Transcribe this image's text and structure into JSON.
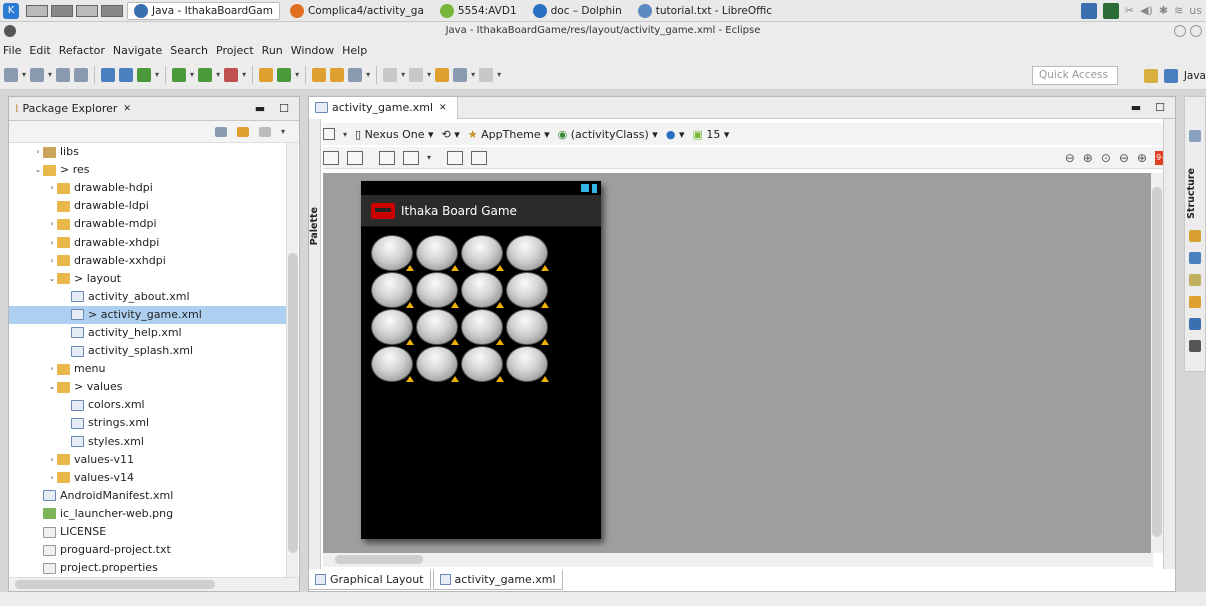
{
  "taskbar": {
    "tasks": [
      {
        "label": "Java - IthakaBoardGam",
        "active": true
      },
      {
        "label": "Complica4/activity_ga"
      },
      {
        "label": "5554:AVD1"
      },
      {
        "label": "doc – Dolphin"
      },
      {
        "label": "tutorial.txt - LibreOffic"
      }
    ],
    "tray_text": "us"
  },
  "window": {
    "title": "Java - IthakaBoardGame/res/layout/activity_game.xml - Eclipse"
  },
  "menu": [
    "File",
    "Edit",
    "Refactor",
    "Navigate",
    "Search",
    "Project",
    "Run",
    "Window",
    "Help"
  ],
  "toolbar": {
    "quick_access_placeholder": "Quick Access",
    "perspective_label": "Java"
  },
  "package_explorer": {
    "title": "Package Explorer",
    "tree": [
      {
        "indent": 1,
        "twisty": ">",
        "icon": "lib",
        "label": "libs"
      },
      {
        "indent": 1,
        "twisty": "v",
        "icon": "folder",
        "label": "> res"
      },
      {
        "indent": 2,
        "twisty": ">",
        "icon": "folder",
        "label": "drawable-hdpi"
      },
      {
        "indent": 2,
        "twisty": "",
        "icon": "folder",
        "label": "drawable-ldpi"
      },
      {
        "indent": 2,
        "twisty": ">",
        "icon": "folder",
        "label": "drawable-mdpi"
      },
      {
        "indent": 2,
        "twisty": ">",
        "icon": "folder",
        "label": "drawable-xhdpi"
      },
      {
        "indent": 2,
        "twisty": ">",
        "icon": "folder",
        "label": "drawable-xxhdpi"
      },
      {
        "indent": 2,
        "twisty": "v",
        "icon": "folder",
        "label": "> layout"
      },
      {
        "indent": 3,
        "twisty": "",
        "icon": "xml",
        "label": "activity_about.xml"
      },
      {
        "indent": 3,
        "twisty": "",
        "icon": "xml",
        "label": "> activity_game.xml",
        "selected": true
      },
      {
        "indent": 3,
        "twisty": "",
        "icon": "xml",
        "label": "activity_help.xml"
      },
      {
        "indent": 3,
        "twisty": "",
        "icon": "xml",
        "label": "activity_splash.xml"
      },
      {
        "indent": 2,
        "twisty": ">",
        "icon": "folder",
        "label": "menu"
      },
      {
        "indent": 2,
        "twisty": "v",
        "icon": "folder",
        "label": "> values"
      },
      {
        "indent": 3,
        "twisty": "",
        "icon": "xml",
        "label": "colors.xml"
      },
      {
        "indent": 3,
        "twisty": "",
        "icon": "xml",
        "label": "strings.xml"
      },
      {
        "indent": 3,
        "twisty": "",
        "icon": "xml",
        "label": "styles.xml"
      },
      {
        "indent": 2,
        "twisty": ">",
        "icon": "folder",
        "label": "values-v11"
      },
      {
        "indent": 2,
        "twisty": ">",
        "icon": "folder",
        "label": "values-v14"
      },
      {
        "indent": 1,
        "twisty": "",
        "icon": "xml",
        "label": "AndroidManifest.xml"
      },
      {
        "indent": 1,
        "twisty": "",
        "icon": "png",
        "label": "ic_launcher-web.png"
      },
      {
        "indent": 1,
        "twisty": "",
        "icon": "txt",
        "label": "LICENSE"
      },
      {
        "indent": 1,
        "twisty": "",
        "icon": "txt",
        "label": "proguard-project.txt"
      },
      {
        "indent": 1,
        "twisty": "",
        "icon": "txt",
        "label": "project.properties"
      }
    ]
  },
  "editor": {
    "tab_label": "activity_game.xml",
    "palette_label": "Palette",
    "config": {
      "device": "Nexus One",
      "theme": "AppTheme",
      "activity": "(activityClass)",
      "api": "15"
    },
    "device_preview": {
      "app_title": "Ithaka Board Game",
      "grid_rows": 4,
      "grid_cols": 4
    },
    "bottom_tabs": [
      "Graphical Layout",
      "activity_game.xml"
    ]
  },
  "structure_label": "Structure",
  "colors": {
    "selection": "#aed0f0",
    "canvas": "#9e9e9e",
    "action_bar": "#2b2b2b"
  }
}
